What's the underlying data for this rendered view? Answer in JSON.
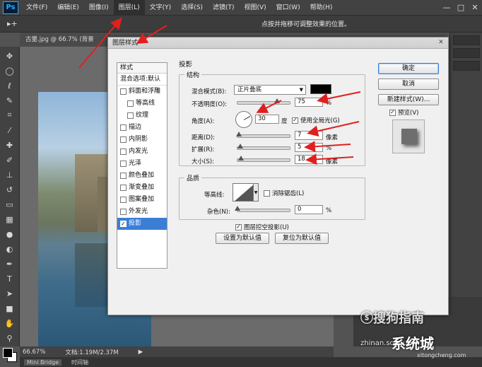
{
  "menubar": {
    "logo": "Ps",
    "items": [
      "文件(F)",
      "编辑(E)",
      "图像(I)",
      "图层(L)",
      "文字(Y)",
      "选择(S)",
      "滤镜(T)",
      "视图(V)",
      "窗口(W)",
      "帮助(H)"
    ],
    "active_index": 3
  },
  "optionsbar": {
    "tool": "▸+",
    "hint": "点按并拖移可调整效果的位置。"
  },
  "document": {
    "tab_title": "古堡.jpg @ 66.7% (背景"
  },
  "status": {
    "zoom": "66.67%",
    "doc_size": "文档:1.19M/2.37M"
  },
  "bottom_tabs": [
    "Mini Bridge",
    "时间轴"
  ],
  "dialog": {
    "title": "图层样式",
    "styles_header": "样式",
    "style_items": [
      {
        "label": "混合选项:默认",
        "checkbox": false,
        "checked": false,
        "indent": false
      },
      {
        "label": "斜面和浮雕",
        "checkbox": true,
        "checked": false,
        "indent": false
      },
      {
        "label": "等高线",
        "checkbox": true,
        "checked": false,
        "indent": true
      },
      {
        "label": "纹理",
        "checkbox": true,
        "checked": false,
        "indent": true
      },
      {
        "label": "描边",
        "checkbox": true,
        "checked": false,
        "indent": false
      },
      {
        "label": "内阴影",
        "checkbox": true,
        "checked": false,
        "indent": false
      },
      {
        "label": "内发光",
        "checkbox": true,
        "checked": false,
        "indent": false
      },
      {
        "label": "光泽",
        "checkbox": true,
        "checked": false,
        "indent": false
      },
      {
        "label": "颜色叠加",
        "checkbox": true,
        "checked": false,
        "indent": false
      },
      {
        "label": "渐变叠加",
        "checkbox": true,
        "checked": false,
        "indent": false
      },
      {
        "label": "图案叠加",
        "checkbox": true,
        "checked": false,
        "indent": false
      },
      {
        "label": "外发光",
        "checkbox": true,
        "checked": false,
        "indent": false
      },
      {
        "label": "投影",
        "checkbox": true,
        "checked": true,
        "indent": false,
        "selected": true
      }
    ],
    "section_title": "投影",
    "structure": {
      "legend": "结构",
      "blend_mode_label": "混合模式(B):",
      "blend_mode_value": "正片叠底",
      "shadow_color": "#000000",
      "opacity_label": "不透明度(O):",
      "opacity_value": "75",
      "opacity_unit": "%",
      "opacity_fraction": 0.75,
      "angle_label": "角度(A):",
      "angle_value": "30",
      "angle_unit": "度",
      "angle_degrees": 30,
      "global_light_label": "使用全局光(G)",
      "global_light_checked": true,
      "distance_label": "距离(D):",
      "distance_value": "7",
      "distance_unit": "像素",
      "distance_fraction": 0.03,
      "spread_label": "扩展(R):",
      "spread_value": "5",
      "spread_unit": "%",
      "spread_fraction": 0.05,
      "size_label": "大小(S):",
      "size_value": "18",
      "size_unit": "像素",
      "size_fraction": 0.07
    },
    "quality": {
      "legend": "品质",
      "contour_label": "等高线:",
      "antialias_label": "消除锯齿(L)",
      "antialias_checked": false,
      "noise_label": "杂色(N):",
      "noise_value": "0",
      "noise_unit": "%",
      "noise_fraction": 0.0
    },
    "knockout_label": "图层挖空投影(U)",
    "knockout_checked": true,
    "make_default_label": "设置为默认值",
    "reset_default_label": "复位为默认值",
    "ok_label": "确定",
    "cancel_label": "取消",
    "new_style_label": "新建样式(W)...",
    "preview_label": "预览(V)",
    "preview_checked": true,
    "check_mark": "✓"
  },
  "watermarks": {
    "sogou": "ⓢ搜狗指南",
    "site_url": "zhinan.sogou.com",
    "xitong": "系统城",
    "xitong_url": "xitongcheng.com"
  },
  "window_controls": [
    "—",
    "□",
    "✕"
  ],
  "annotation_color": "#e02020",
  "accent_color": "#3b7ed6"
}
